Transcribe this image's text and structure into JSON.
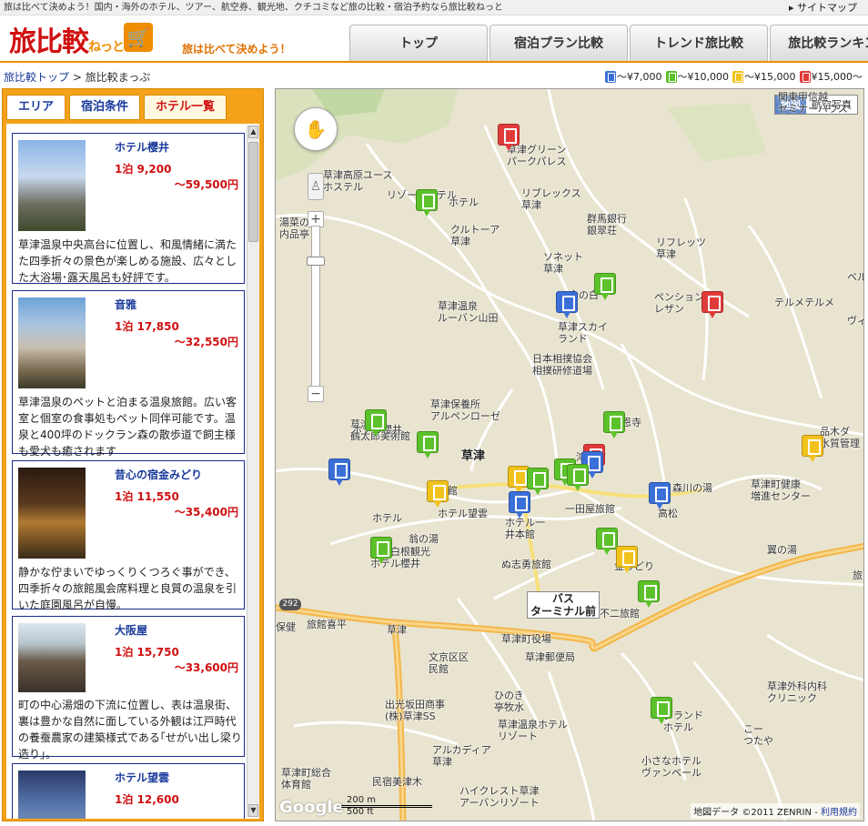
{
  "topbar": {
    "tagline": "旅は比べて決めよう！国内・海外のホテル、ツアー、航空券、観光地、クチコミなど旅の比較・宿泊予約なら旅比較ねっと",
    "sitemap": "サイトマップ"
  },
  "header": {
    "logo": "旅比較",
    "logo_sub": "ねっと",
    "slogan": "旅は比べて決めよう！",
    "nav": [
      "トップ",
      "宿泊プラン比較",
      "トレンド旅比較",
      "旅比較ランキング"
    ]
  },
  "breadcrumb": {
    "home": "旅比較トップ",
    "sep": ">",
    "current": "旅比較まっぷ"
  },
  "legend": [
    {
      "color": "#3b6fd8",
      "label": "～¥7,000"
    },
    {
      "color": "#5cc12a",
      "label": "～¥10,000"
    },
    {
      "color": "#f2c21c",
      "label": "～¥15,000"
    },
    {
      "color": "#e03a3a",
      "label": "¥15,000～"
    }
  ],
  "left_tabs": [
    "エリア",
    "宿泊条件",
    "ホテル一覧"
  ],
  "hotels": [
    {
      "name": "ホテル櫻井",
      "price_from": "1泊 9,200",
      "price_to": "～59,500円",
      "desc": "草津温泉中央高台に位置し、和風情緒に満たた四季折々の景色が楽しめる施設、広々とした大浴場･露天風呂も好評です。"
    },
    {
      "name": "音雅",
      "price_from": "1泊 17,850",
      "price_to": "～32,550円",
      "desc": "草津温泉のペットと泊まる温泉旅館。広い客室と個室の食事処もペット同伴可能です。温泉と400坪のドックラン森の散歩道で飼主様も愛犬も癒されます"
    },
    {
      "name": "昔心の宿金みどり",
      "price_from": "1泊 11,550",
      "price_to": "～35,400円",
      "desc": "静かな佇まいでゆっくりくつろぐ事ができ、四季折々の旅館風会席料理と良質の温泉を引いた庭園風呂が自慢。"
    },
    {
      "name": "大阪屋",
      "price_from": "1泊 15,750",
      "price_to": "～33,600円",
      "desc": "町の中心湯畑の下流に位置し、表は温泉街、裏は豊かな自然に面している外観は江戸時代の養蚕農家の建築様式である｢せがい出し梁り造り｣。"
    },
    {
      "name": "ホテル望雲",
      "price_from": "1泊 12,600",
      "price_to": "",
      "desc": ""
    }
  ],
  "map": {
    "type_buttons": [
      "地図",
      "航空写真"
    ],
    "town_label": "草津",
    "road_number": "292",
    "bus_terminal": "バス\nターミナル前",
    "scale": [
      "200 m",
      "500 ft"
    ],
    "attribution": "地図データ ©2011 ZENRIN",
    "terms": "利用規約",
    "google": "Google",
    "labels": [
      "草津グリーン\nパークパレス",
      "草津高原ユース\nホステル",
      "リゾートホテル",
      "湯菜の\n内品亭",
      "リブレックス\n草津",
      "クルトーア\n草津",
      "群馬銀行\n銀翠荘",
      "リフレッツ\n草津",
      "ソネット\n草津",
      "ペンション\nレザン",
      "テルメテルメ",
      "草津温泉\nルーバン山田",
      "草津スカイ\nランド",
      "日本相撲協会\n相撲研修道場",
      "草津保養所\nアルペンローゼ",
      "草津町\n鶴太郎美術館",
      "草津町健康\n増進センター",
      "森川の湯",
      "ホテル望雲",
      "ホテル一\n井本館",
      "一田屋旅館",
      "高松",
      "草津白根観光\nホテル櫻井",
      "ぬ志勇旅館",
      "金みどり",
      "不二旅館",
      "旅館喜平",
      "草津",
      "草津町役場",
      "文京区区\n民館",
      "草津郵便局",
      "出光坂田商事\n(株)草津SS",
      "ひのき\n亭牧水",
      "草津温泉ホテル\nリゾート",
      "アルカディア\n草津",
      "草津町総合\n体育館",
      "民宿美津木",
      "ハイクレスト草津\nアーバンリゾート",
      "小さなホテル\nヴァンベール",
      "グランド\nホテル",
      "草津外科内科\nクリニック",
      "こー\nつたや",
      "翼の湯",
      "品木ダ\n水質管理",
      "関東甲信越\nセミナーハウス",
      "翁の湯",
      "ベル",
      "ヴィ",
      "旅",
      "保健",
      "ホテル",
      "楽館",
      "鴻旅館",
      "恩寺",
      "ホテル櫻井",
      "金の白",
      "ホテル"
    ]
  }
}
